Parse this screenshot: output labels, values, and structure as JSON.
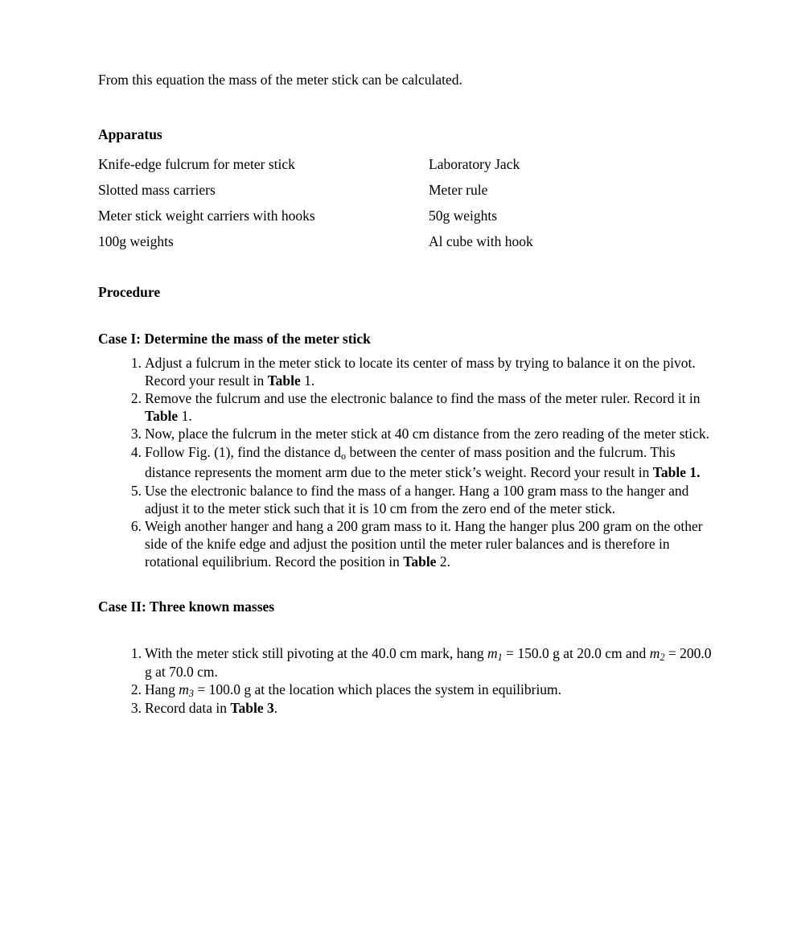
{
  "document": {
    "background_color": "#ffffff",
    "text_color": "#000000",
    "intro_paragraph": "From this equation the mass of the meter stick can be calculated."
  },
  "apparatus": {
    "heading": "Apparatus",
    "rows": [
      {
        "left": "Knife-edge fulcrum for meter stick",
        "right": "Laboratory Jack"
      },
      {
        "left": "Slotted mass carriers",
        "right": "Meter rule"
      },
      {
        "left": "Meter stick weight carriers with hooks",
        "right": "50g weights"
      },
      {
        "left": "100g weights",
        "right": "Al cube with hook"
      }
    ]
  },
  "procedure": {
    "heading": "Procedure"
  },
  "case1": {
    "heading": "Case I: Determine the mass of the meter stick",
    "items": [
      {
        "number": "1.",
        "segments": [
          {
            "t": "Adjust a fulcrum in the meter stick to locate its center of mass by trying to balance it on the pivot. Record your result in "
          },
          {
            "t": "Table",
            "b": true
          },
          {
            "t": " 1."
          }
        ]
      },
      {
        "number": "2.",
        "segments": [
          {
            "t": "Remove the fulcrum and use the electronic balance to find the mass of the meter ruler. Record it in "
          },
          {
            "t": "Table",
            "b": true
          },
          {
            "t": " 1."
          }
        ]
      },
      {
        "number": "3.",
        "segments": [
          {
            "t": "Now, place the fulcrum in the meter stick at 40 cm distance from the zero reading of the meter stick."
          }
        ]
      },
      {
        "number": "4.",
        "loose": true,
        "segments": [
          {
            "t": "Follow Fig. (1), find the distance d"
          },
          {
            "t": "o",
            "sub": true
          },
          {
            "t": " between the center of mass position and the fulcrum. This distance represents the moment arm due to the meter stick’s weight. Record your result in "
          },
          {
            "t": "Table 1.",
            "b": true
          }
        ]
      },
      {
        "number": "5.",
        "segments": [
          {
            "t": "Use the electronic balance to find the mass of a hanger. Hang a 100 gram mass to the hanger and adjust it to the meter stick such that it is 10 cm from the zero end of the meter stick."
          }
        ]
      },
      {
        "number": "6.",
        "segments": [
          {
            "t": "Weigh another hanger and hang a 200 gram mass to it. Hang the hanger plus 200 gram on the other side of the knife edge and adjust the position until the meter ruler balances and is therefore in rotational equilibrium. Record the position in "
          },
          {
            "t": "Table",
            "b": true
          },
          {
            "t": " 2."
          }
        ]
      }
    ]
  },
  "case2": {
    "heading": "Case II: Three known masses",
    "items": [
      {
        "number": "1.",
        "segments": [
          {
            "t": "With the meter stick still pivoting at the 40.0 cm mark, hang "
          },
          {
            "t": "m",
            "i": true
          },
          {
            "t": "1",
            "sub": true,
            "i": true
          },
          {
            "t": " = 150.0 g at 20.0 cm and "
          },
          {
            "t": "m",
            "i": true
          },
          {
            "t": "2",
            "sub": true,
            "i": true
          },
          {
            "t": " = 200.0 g at 70.0 cm."
          }
        ]
      },
      {
        "number": "2.",
        "segments": [
          {
            "t": "Hang "
          },
          {
            "t": "m",
            "i": true
          },
          {
            "t": "3",
            "sub": true,
            "i": true
          },
          {
            "t": " = 100.0 g at the location which places the system in equilibrium."
          }
        ]
      },
      {
        "number": "3.",
        "segments": [
          {
            "t": "Record data in "
          },
          {
            "t": "Table 3",
            "b": true
          },
          {
            "t": "."
          }
        ]
      }
    ]
  }
}
